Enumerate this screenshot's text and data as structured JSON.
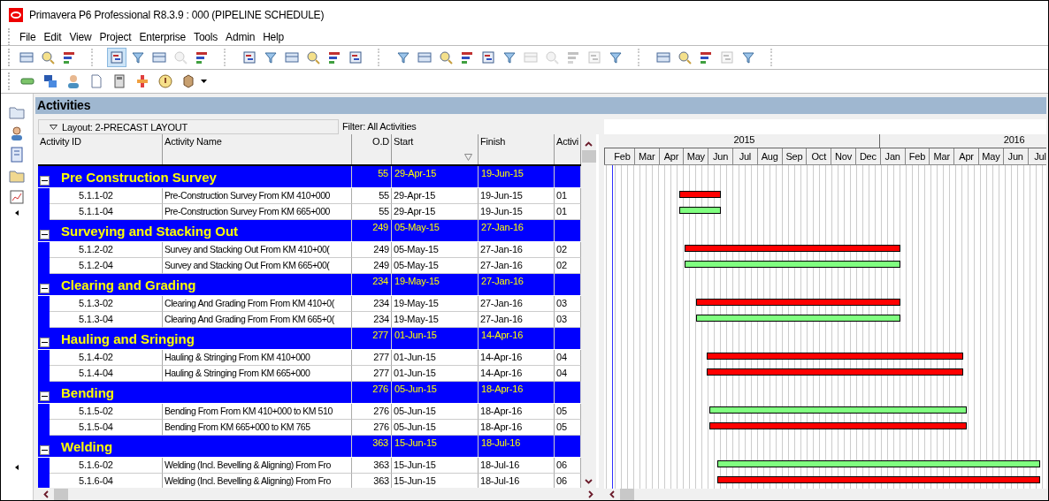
{
  "window": {
    "title": "Primavera P6 Professional R8.3.9 : 000 (PIPELINE SCHEDULE)"
  },
  "menu": [
    "File",
    "Edit",
    "View",
    "Project",
    "Enterprise",
    "Tools",
    "Admin",
    "Help"
  ],
  "toolbar_1": [
    {
      "disabled": false,
      "selected": false
    },
    {
      "disabled": false,
      "selected": false
    },
    {
      "disabled": false,
      "selected": false
    },
    {
      "disabled": false,
      "selected": true
    },
    {
      "disabled": false,
      "selected": false
    },
    {
      "disabled": false,
      "selected": false
    },
    {
      "disabled": true,
      "selected": false
    },
    {
      "disabled": false,
      "selected": false
    },
    {
      "disabled": false,
      "selected": false
    },
    {
      "disabled": false,
      "selected": false
    },
    {
      "disabled": false,
      "selected": false
    },
    {
      "disabled": false,
      "selected": false
    },
    {
      "disabled": false,
      "selected": false
    },
    {
      "disabled": false,
      "selected": false
    },
    {
      "disabled": false,
      "selected": false
    },
    {
      "disabled": false,
      "selected": false
    },
    {
      "disabled": false,
      "selected": false
    },
    {
      "disabled": false,
      "selected": false
    },
    {
      "disabled": false,
      "selected": false
    },
    {
      "disabled": false,
      "selected": false
    },
    {
      "disabled": true,
      "selected": false
    },
    {
      "disabled": true,
      "selected": false
    },
    {
      "disabled": true,
      "selected": false
    },
    {
      "disabled": true,
      "selected": false
    },
    {
      "disabled": false,
      "selected": false
    },
    {
      "disabled": false,
      "selected": false
    },
    {
      "disabled": false,
      "selected": false
    },
    {
      "disabled": false,
      "selected": false
    },
    {
      "disabled": true,
      "selected": false
    },
    {
      "disabled": false,
      "selected": false
    }
  ],
  "panel": {
    "title": "Activities",
    "layout": "Layout: 2-PRECAST LAYOUT",
    "filter": "Filter: All Activities"
  },
  "columns": [
    "Activity ID",
    "Activity Name",
    "O.D",
    "Start",
    "Finish",
    "Activi"
  ],
  "timescale": {
    "years": [
      {
        "label": "2015",
        "months": [
          "Feb",
          "Mar",
          "Apr",
          "May",
          "Jun",
          "Jul",
          "Aug",
          "Sep",
          "Oct",
          "Nov",
          "Dec"
        ]
      },
      {
        "label": "2016",
        "months": [
          "Jan",
          "Feb",
          "Mar",
          "Apr",
          "May",
          "Jun",
          "Jul"
        ]
      }
    ]
  },
  "groups": [
    {
      "name": "Pre Construction Survey",
      "od": "55",
      "start": "29-Apr-15",
      "finish": "19-Jun-15",
      "expanded": true,
      "children": [
        {
          "id": "5.1.1-02",
          "name": "Pre-Construction Survey From KM 410+000",
          "od": "55",
          "start": "29-Apr-15",
          "finish": "19-Jun-15",
          "code": "01",
          "color": "#ff0000"
        },
        {
          "id": "5.1.1-04",
          "name": "Pre-Construction Survey  From KM 665+000",
          "od": "55",
          "start": "29-Apr-15",
          "finish": "19-Jun-15",
          "code": "01",
          "color": "#80ff80"
        }
      ]
    },
    {
      "name": "Surveying and Stacking Out",
      "od": "249",
      "start": "05-May-15",
      "finish": "27-Jan-16",
      "expanded": true,
      "children": [
        {
          "id": "5.1.2-02",
          "name": "Survey and Stacking Out  From KM 410+00(",
          "od": "249",
          "start": "05-May-15",
          "finish": "27-Jan-16",
          "code": "02",
          "color": "#ff0000"
        },
        {
          "id": "5.1.2-04",
          "name": "Survey and Stacking Out From KM 665+00(",
          "od": "249",
          "start": "05-May-15",
          "finish": "27-Jan-16",
          "code": "02",
          "color": "#80ff80"
        }
      ]
    },
    {
      "name": "Clearing and Grading",
      "od": "234",
      "start": "19-May-15",
      "finish": "27-Jan-16",
      "expanded": true,
      "children": [
        {
          "id": "5.1.3-02",
          "name": "Clearing And Grading From From KM 410+0(",
          "od": "234",
          "start": "19-May-15",
          "finish": "27-Jan-16",
          "code": "03",
          "color": "#ff0000"
        },
        {
          "id": "5.1.3-04",
          "name": "Clearing And Grading From From KM 665+0(",
          "od": "234",
          "start": "19-May-15",
          "finish": "27-Jan-16",
          "code": "03",
          "color": "#80ff80"
        }
      ]
    },
    {
      "name": "Hauling and Sringing",
      "od": "277",
      "start": "01-Jun-15",
      "finish": "14-Apr-16",
      "expanded": true,
      "children": [
        {
          "id": "5.1.4-02",
          "name": "Hauling & Stringing From KM 410+000",
          "od": "277",
          "start": "01-Jun-15",
          "finish": "14-Apr-16",
          "code": "04",
          "color": "#ff0000"
        },
        {
          "id": "5.1.4-04",
          "name": "Hauling & Stringing From KM 665+000",
          "od": "277",
          "start": "01-Jun-15",
          "finish": "14-Apr-16",
          "code": "04",
          "color": "#ff0000"
        }
      ]
    },
    {
      "name": "Bending",
      "od": "276",
      "start": "05-Jun-15",
      "finish": "18-Apr-16",
      "expanded": true,
      "children": [
        {
          "id": "5.1.5-02",
          "name": "Bending From From KM 410+000 to KM 510",
          "od": "276",
          "start": "05-Jun-15",
          "finish": "18-Apr-16",
          "code": "05",
          "color": "#80ff80"
        },
        {
          "id": "5.1.5-04",
          "name": "Bending From KM 665+000 to KM 765",
          "od": "276",
          "start": "05-Jun-15",
          "finish": "18-Apr-16",
          "code": "05",
          "color": "#ff0000"
        }
      ]
    },
    {
      "name": "Welding",
      "od": "363",
      "start": "15-Jun-15",
      "finish": "18-Jul-16",
      "expanded": true,
      "children": [
        {
          "id": "5.1.6-02",
          "name": "Welding (Incl. Bevelling & Aligning) From Fro",
          "od": "363",
          "start": "15-Jun-15",
          "finish": "18-Jul-16",
          "code": "06",
          "color": "#80ff80"
        },
        {
          "id": "5.1.6-04",
          "name": "Welding (Incl. Bevelling & Aligning) From Fro",
          "od": "363",
          "start": "15-Jun-15",
          "finish": "18-Jul-16",
          "code": "06",
          "color": "#ff0000"
        }
      ]
    }
  ]
}
